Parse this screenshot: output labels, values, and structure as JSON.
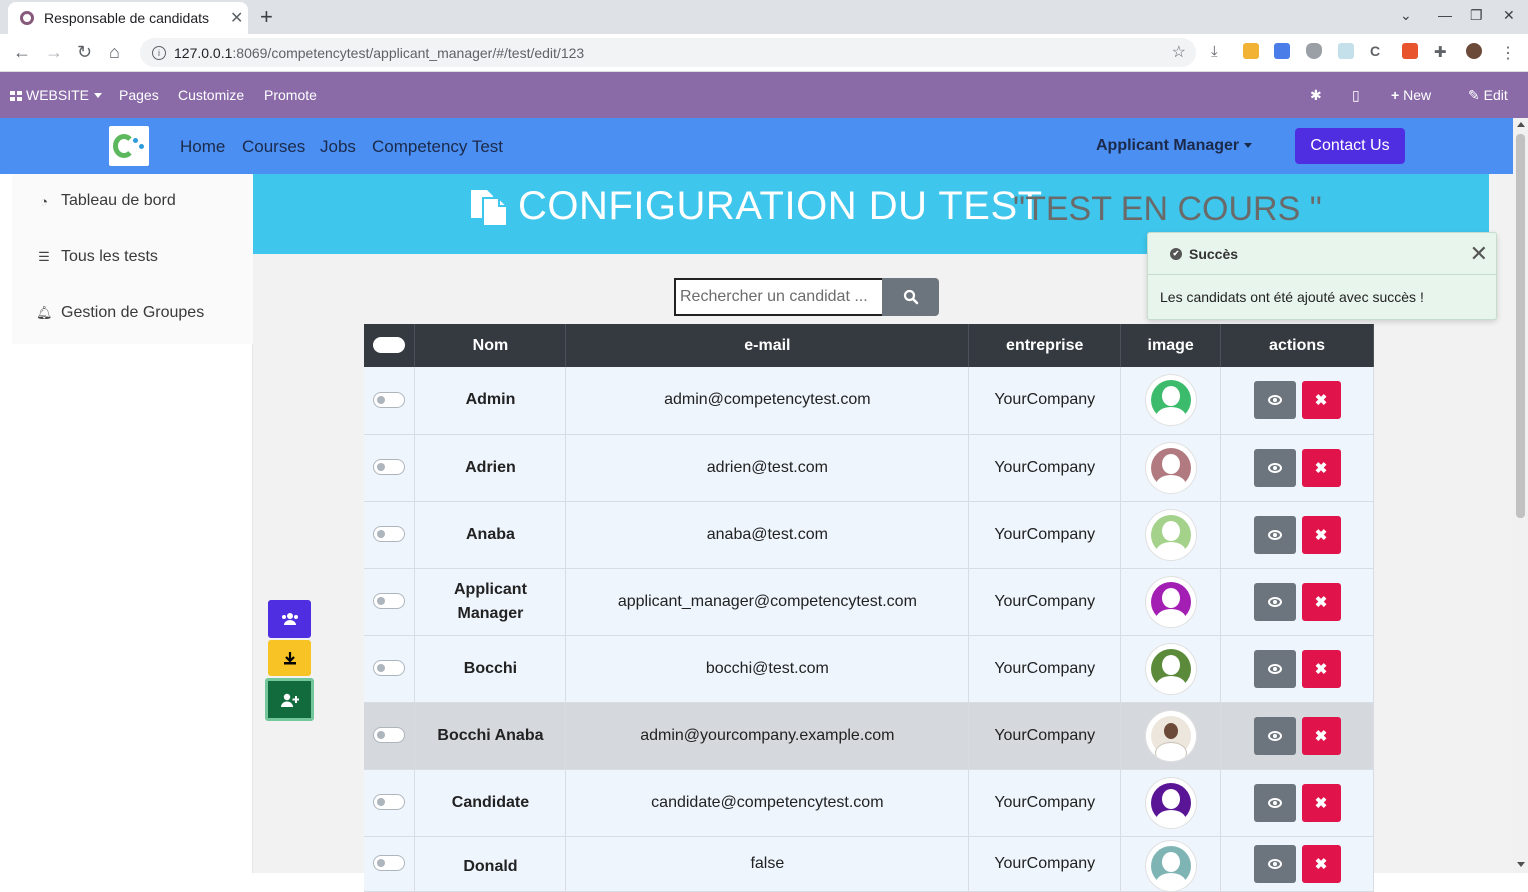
{
  "browser": {
    "tab_title": "Responsable de candidats",
    "url_host": "127.0.0.1",
    "url_path": ":8069/competencytest/applicant_manager/#/test/edit/123"
  },
  "odoo_bar": {
    "website": "WEBSITE",
    "pages": "Pages",
    "customize": "Customize",
    "promote": "Promote",
    "new": "New",
    "edit": "Edit"
  },
  "site_nav": {
    "home": "Home",
    "courses": "Courses",
    "jobs": "Jobs",
    "competency_test": "Competency Test",
    "applicant_manager": "Applicant Manager",
    "contact_us": "Contact Us"
  },
  "sidebar": {
    "items": [
      {
        "label": "Tableau de bord",
        "icon": "dashboard-icon"
      },
      {
        "label": "Tous les tests",
        "icon": "list-icon"
      },
      {
        "label": "Gestion de Groupes",
        "icon": "bell-icon"
      }
    ]
  },
  "banner": {
    "title": "CONFIGURATION DU TEST",
    "subtitle": "\"TEST EN COURS \""
  },
  "search": {
    "placeholder": "Rechercher un candidat ..."
  },
  "toast": {
    "title": "Succès",
    "message": "Les candidats ont été ajouté avec succès !"
  },
  "table": {
    "headers": [
      "Nom",
      "e-mail",
      "entreprise",
      "image",
      "actions"
    ],
    "rows": [
      {
        "name": "Admin",
        "email": "admin@competencytest.com",
        "company": "YourCompany",
        "avatar_color": "#3dbb6c"
      },
      {
        "name": "Adrien",
        "email": "adrien@test.com",
        "company": "YourCompany",
        "avatar_color": "#b07a80"
      },
      {
        "name": "Anaba",
        "email": "anaba@test.com",
        "company": "YourCompany",
        "avatar_color": "#a4d28a"
      },
      {
        "name": "Applicant Manager",
        "email": "applicant_manager@competencytest.com",
        "company": "YourCompany",
        "avatar_color": "#a31fb3"
      },
      {
        "name": "Bocchi",
        "email": "bocchi@test.com",
        "company": "YourCompany",
        "avatar_color": "#5a8a3a"
      },
      {
        "name": "Bocchi Anaba",
        "email": "admin@yourcompany.example.com",
        "company": "YourCompany",
        "avatar_color": "#d9cfc0"
      },
      {
        "name": "Candidate",
        "email": "candidate@competencytest.com",
        "company": "YourCompany",
        "avatar_color": "#5a1596"
      },
      {
        "name": "Donald",
        "email": "false",
        "company": "YourCompany",
        "avatar_color": "#7fb4b4"
      }
    ]
  },
  "colors": {
    "odoo_bar": "#8a6ba8",
    "header": "#4c8ff3",
    "banner": "#3ec6ec",
    "contact_btn": "#4f2de0",
    "delete_btn": "#e0134a",
    "view_btn": "#6c757d",
    "fab_group": "#4f2de0",
    "fab_download": "#f7c325",
    "fab_add_user": "#126b3d"
  }
}
